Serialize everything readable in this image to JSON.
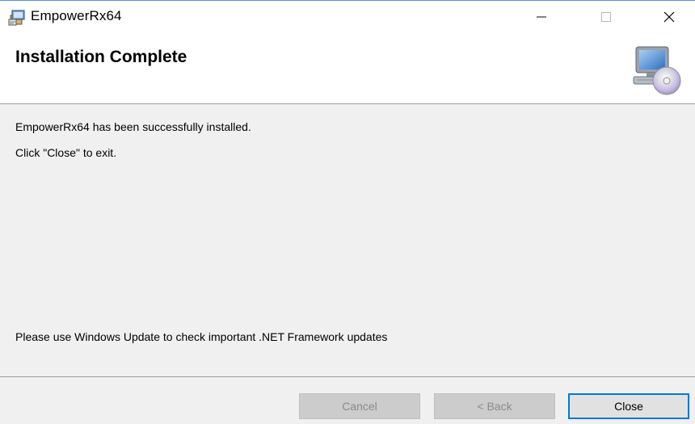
{
  "window": {
    "title": "EmpowerRx64",
    "accent_color": "#0078d7",
    "icons": {
      "app": "installer-package-icon",
      "minimize": "minimize-icon",
      "maximize": "maximize-icon",
      "close": "close-icon",
      "header": "computer-cd-icon"
    }
  },
  "header": {
    "title": "Installation Complete"
  },
  "content": {
    "message_installed": "EmpowerRx64 has been successfully installed.",
    "message_close": "Click \"Close\" to exit.",
    "message_updates": "Please use Windows Update to check important .NET Framework updates"
  },
  "buttons": {
    "cancel": "Cancel",
    "back": "< Back",
    "close": "Close"
  }
}
